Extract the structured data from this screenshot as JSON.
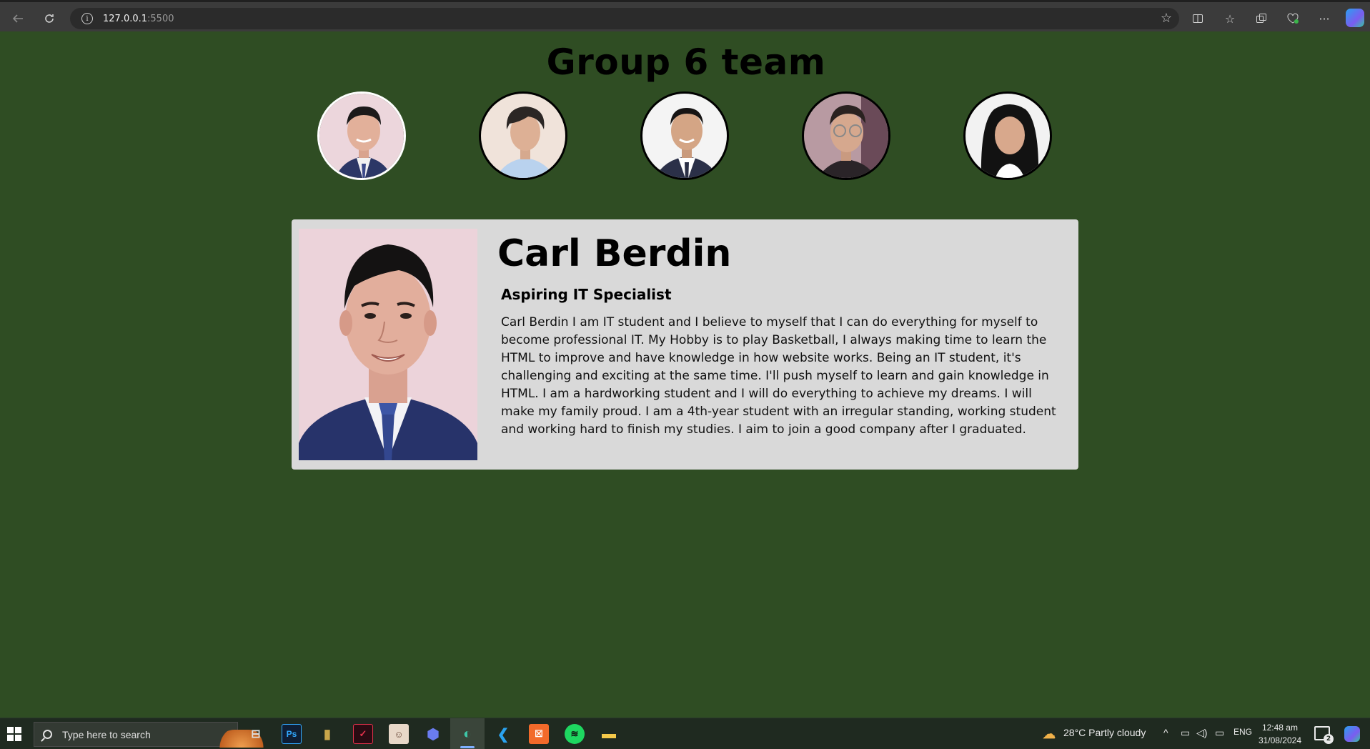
{
  "browser": {
    "url_host": "127.0.0.1",
    "url_port": ":5500"
  },
  "page": {
    "title": "Group 6 team",
    "members": [
      {
        "name": "Carl Berdin",
        "active": true
      },
      {
        "name": "member-2",
        "active": false
      },
      {
        "name": "member-3",
        "active": false
      },
      {
        "name": "member-4",
        "active": false
      },
      {
        "name": "member-5",
        "active": false
      }
    ],
    "profile": {
      "name": "Carl Berdin",
      "role": "Aspiring IT Specialist",
      "bio": "Carl Berdin I am IT student and I believe to myself that I can do everything for myself to become professional IT. My Hobby is to play Basketball, I always making time to learn the HTML to improve and have knowledge in how website works. Being an IT student, it's challenging and exciting at the same time. I'll push myself to learn and gain knowledge in HTML. I am a hardworking student and I will do everything to achieve my dreams. I will make my family proud. I am a 4th-year student with an irregular standing, working student and working hard to finish my studies. I aim to join a good company after I graduated."
    }
  },
  "taskbar": {
    "search_placeholder": "Type here to search",
    "apps": [
      "task-view",
      "photoshop",
      "book-app",
      "vivaldi",
      "game-app",
      "copilot-app",
      "edge",
      "vscode",
      "xampp",
      "spotify",
      "file-explorer"
    ],
    "weather": "28°C  Partly cloudy",
    "language": "ENG",
    "time": "12:48 am",
    "date": "31/08/2024",
    "notification_count": "2"
  },
  "colors": {
    "page_background": "#2f4d23",
    "card_background": "#d9d9d9"
  }
}
